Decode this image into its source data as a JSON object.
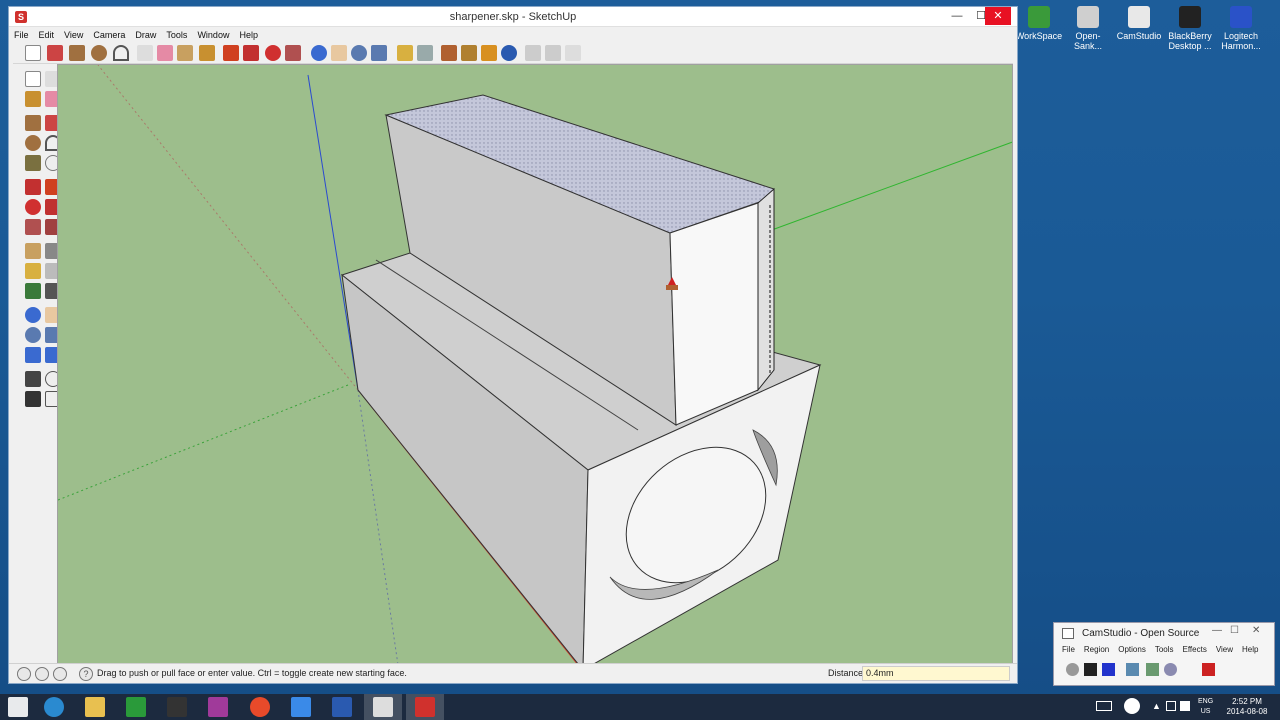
{
  "desktop": {
    "icons": [
      {
        "label": "WorkSpace",
        "color": "#3a9a3a"
      },
      {
        "label": "Open-Sank...",
        "color": "#cfcfcf"
      },
      {
        "label": "CamStudio",
        "color": "#e8e8e8"
      },
      {
        "label": "BlackBerry Desktop ...",
        "color": "#222222"
      },
      {
        "label": "Logitech Harmon...",
        "color": "#2a52c8"
      }
    ]
  },
  "window": {
    "title": "sharpener.skp - SketchUp",
    "minimize_icon": "minimize-icon",
    "maximize_icon": "maximize-icon",
    "close_symbol": "✕",
    "minimize_symbol": "—",
    "maximize_symbol": "☐"
  },
  "menubar": {
    "items": [
      "File",
      "Edit",
      "View",
      "Camera",
      "Draw",
      "Tools",
      "Window",
      "Help"
    ]
  },
  "statusbar": {
    "hint": "Drag to push or pull face or enter value.  Ctrl = toggle create new starting face.",
    "measure_label": "Distance",
    "measure_value": "0.4mm",
    "help_symbol": "?"
  },
  "camstudio": {
    "title": "CamStudio - Open Source",
    "menu": [
      "File",
      "Region",
      "Options",
      "Tools",
      "Effects",
      "View",
      "Help"
    ],
    "close_symbol": "✕",
    "minimize_symbol": "—",
    "maximize_symbol": "☐"
  },
  "taskbar": {
    "language_top": "ENG",
    "language_bottom": "US",
    "time": "2:52 PM",
    "date": "2014-08-08"
  },
  "colors": {
    "viewport_bg": "#9dbe8c",
    "face_light": "#f4f4f4",
    "face_shaded": "#c9c9c9",
    "top_face": "#b9bcd2",
    "axis_red": "#d23a2a",
    "axis_green": "#2fb52f",
    "axis_blue": "#2a4ad0"
  }
}
